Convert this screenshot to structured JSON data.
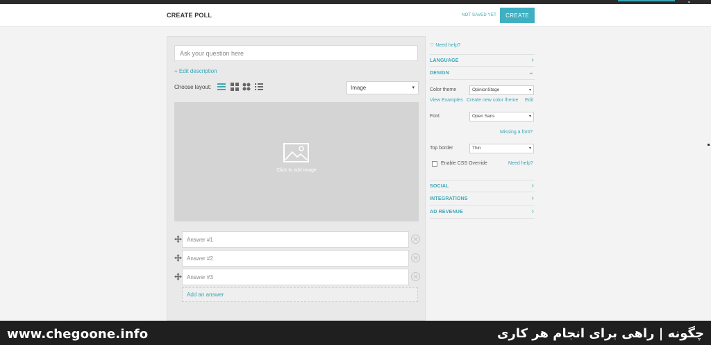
{
  "header": {
    "title": "CREATE POLL",
    "save_status": "NOT SAVED YET",
    "create_label": "CREATE"
  },
  "editor": {
    "question_placeholder": "Ask your question here",
    "edit_description": "+ Edit description",
    "layout_label": "Choose layout:",
    "layouts": [
      "list-layout-icon",
      "grid-layout-icon",
      "circles-layout-icon",
      "bullets-layout-icon"
    ],
    "media_type": "Image",
    "image_prompt": "Click to add image",
    "answers": [
      {
        "placeholder": "Answer #1"
      },
      {
        "placeholder": "Answer #2"
      },
      {
        "placeholder": "Answer #3"
      }
    ],
    "add_answer": "Add an answer"
  },
  "panel": {
    "need_help_top": "Need help?",
    "sections": {
      "language": "LANGUAGE",
      "design": "DESIGN",
      "social": "SOCIAL",
      "integrations": "INTEGRATIONS",
      "ad_revenue": "AD REVENUE"
    },
    "color_theme_label": "Color theme",
    "color_theme_value": "OpinionStage",
    "view_examples": "View Examples",
    "create_color_theme": "Create new color theme",
    "edit": "Edit",
    "font_label": "Font",
    "font_value": "Open Sans",
    "missing_font": "Missing a font?",
    "top_border_label": "Top border",
    "top_border_value": "Thin",
    "css_override_label": "Enable CSS Override",
    "need_help_css": "Need help?"
  },
  "footer": {
    "url": "www.chegoone.info",
    "tagline": "چگونه | راهی برای انجام هر کاری"
  },
  "colors": {
    "accent": "#3aa7b8",
    "button": "#3fb0c2",
    "footer_bg": "#1f1f1f"
  }
}
